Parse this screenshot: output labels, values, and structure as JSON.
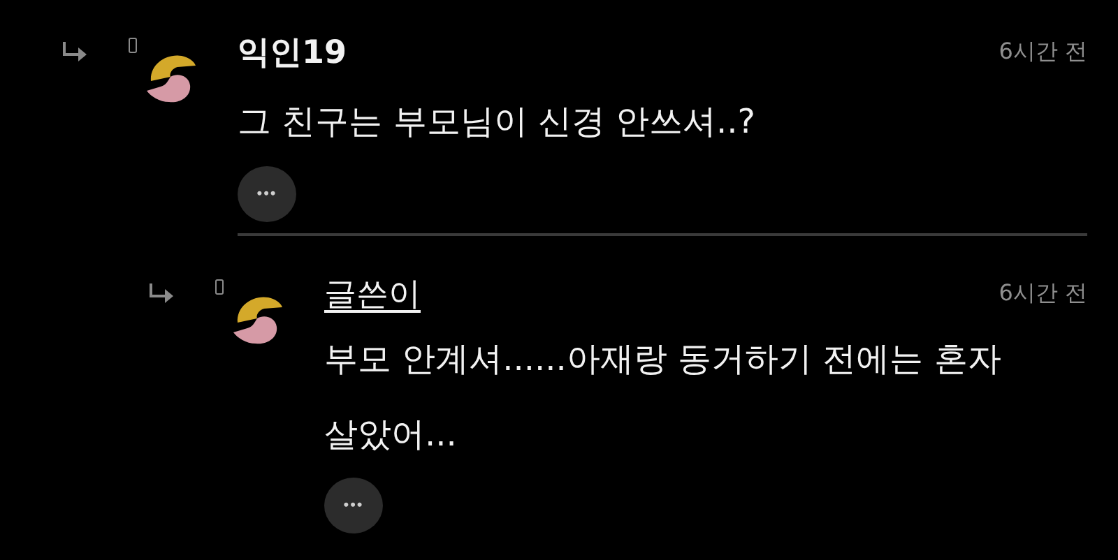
{
  "comments": [
    {
      "author": "익인19",
      "is_author": false,
      "time": "6시간 전",
      "body": "그 친구는 부모님이 신경 안쓰셔..?",
      "more": "•••",
      "children": [
        {
          "author": "글쓴이",
          "is_author": true,
          "time": "6시간 전",
          "body": "부모 안계셔......아재랑 동거하기 전에는 혼자 살았어...",
          "more": "•••"
        }
      ]
    }
  ]
}
